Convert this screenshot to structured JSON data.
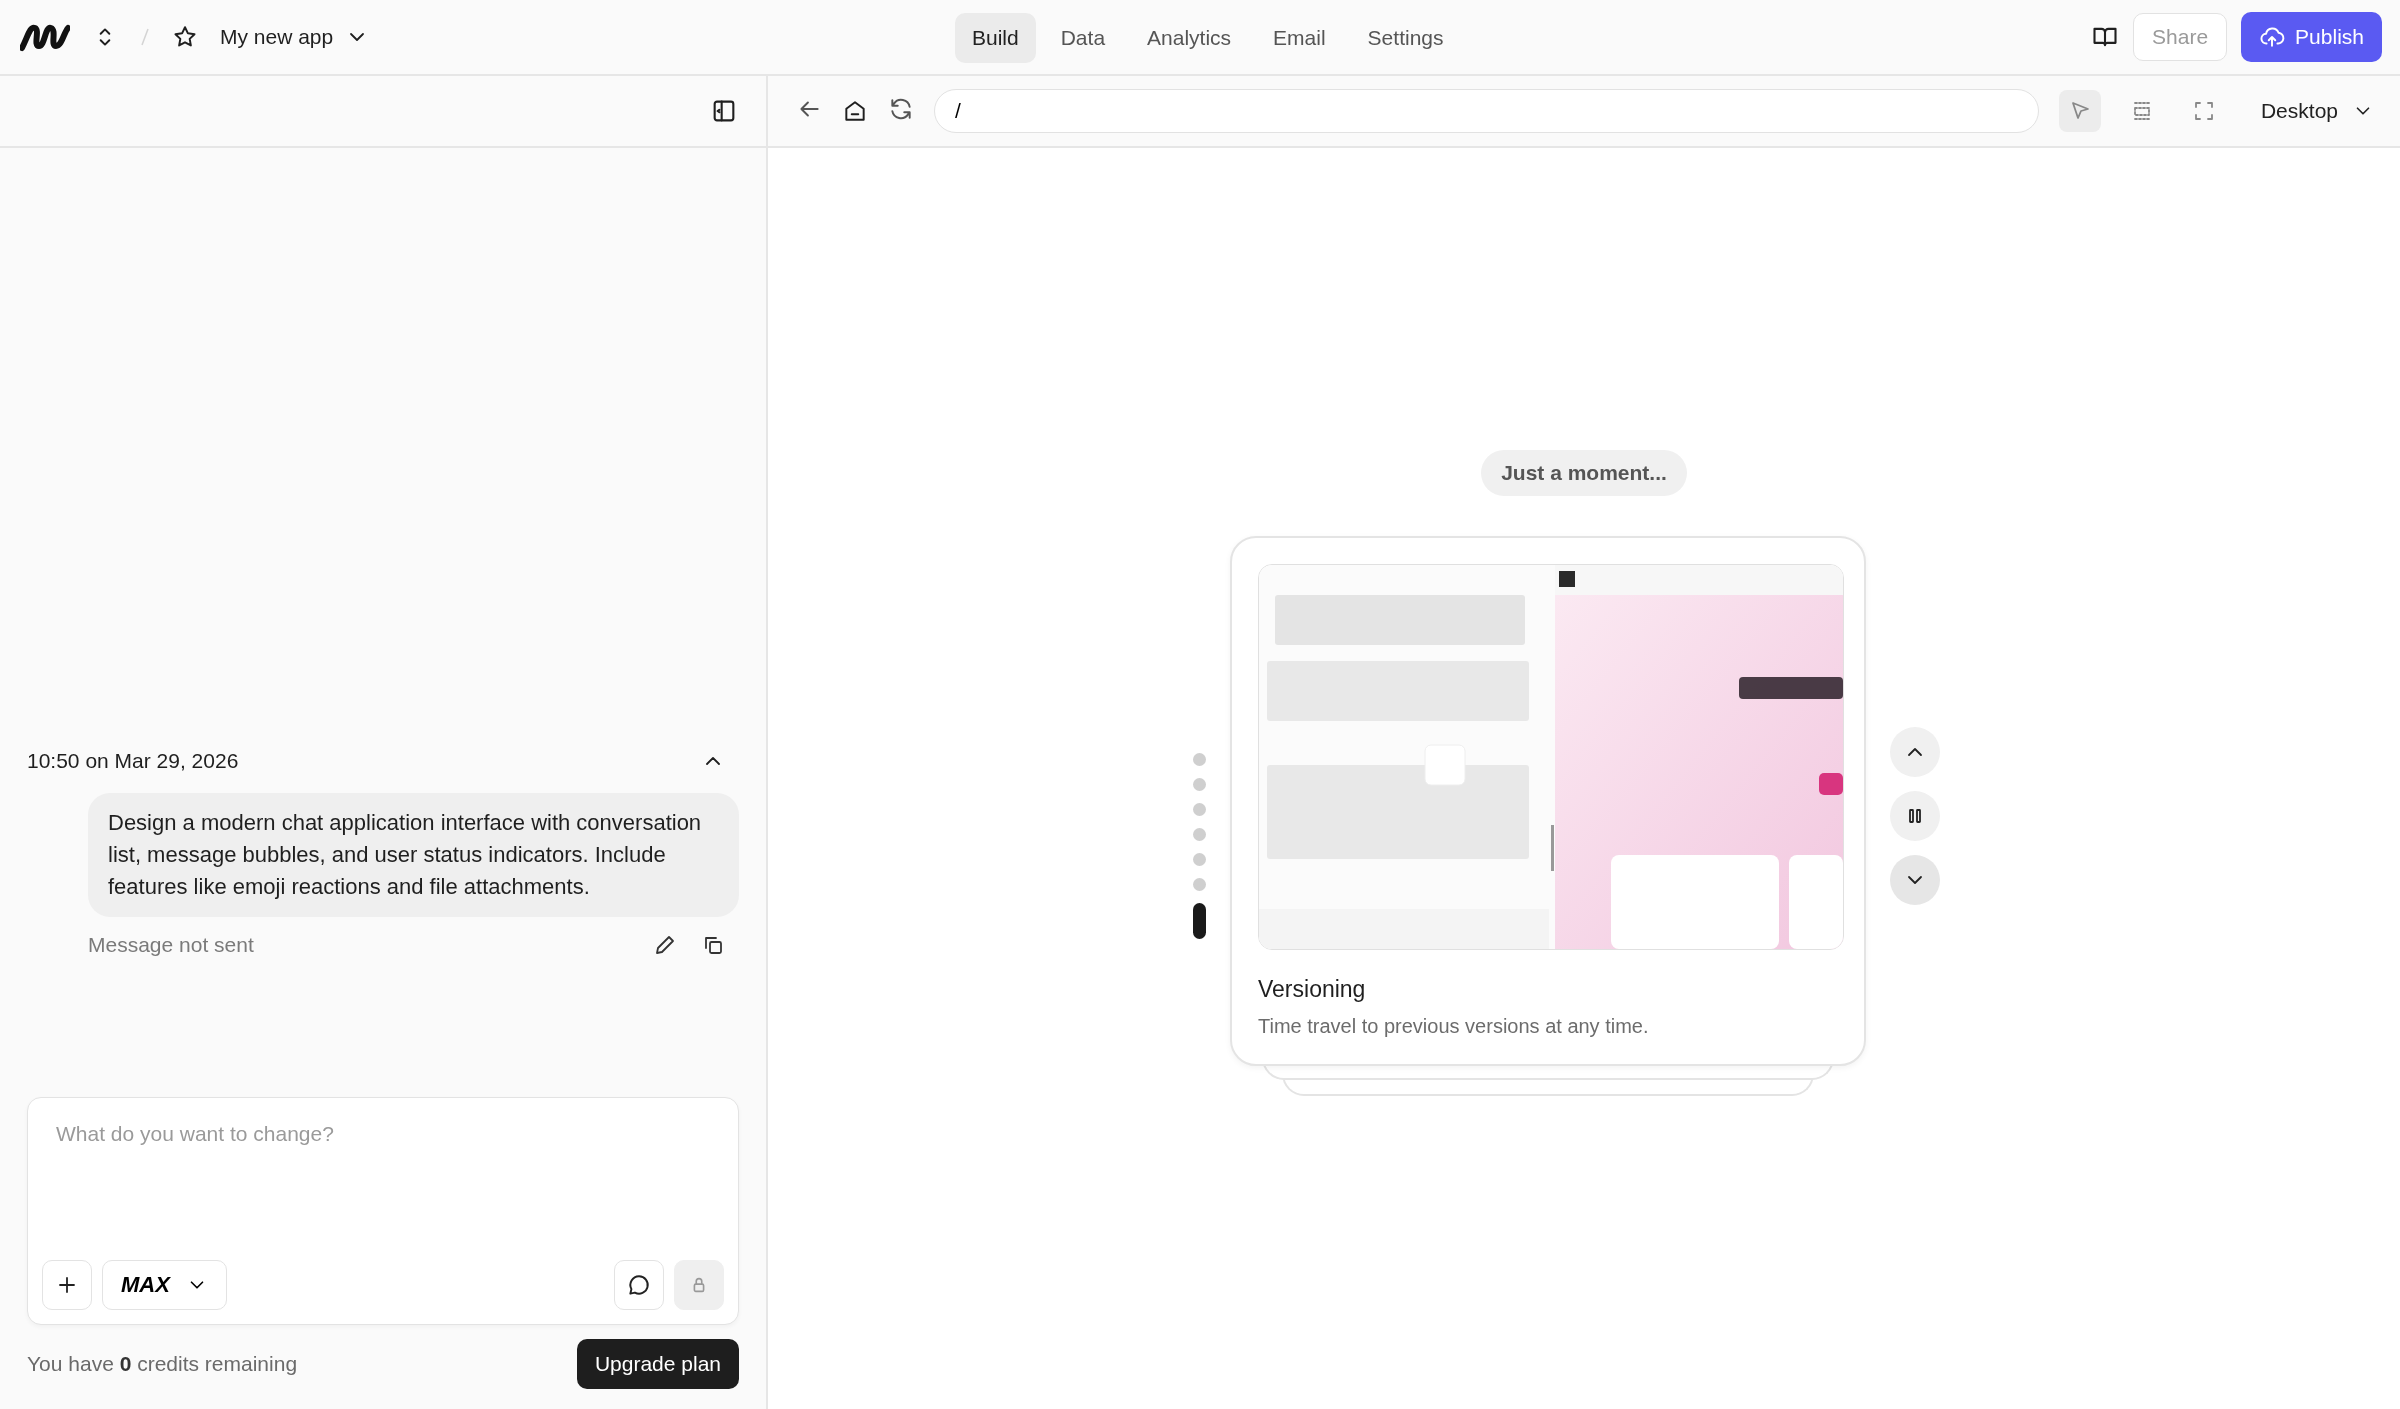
{
  "topbar": {
    "app_name": "My new app",
    "tabs": [
      {
        "label": "Build",
        "selected": true
      },
      {
        "label": "Data",
        "selected": false
      },
      {
        "label": "Analytics",
        "selected": false
      },
      {
        "label": "Email",
        "selected": false
      },
      {
        "label": "Settings",
        "selected": false
      }
    ],
    "share": "Share",
    "publish": "Publish"
  },
  "chat": {
    "timestamp": "10:50 on Mar 29, 2026",
    "message": "Design a modern chat application interface with conversation list, message bubbles, and user status indicators. Include features like emoji reactions and file attachments.",
    "status": "Message not sent",
    "composer": {
      "placeholder": "What do you want to change?",
      "model": "MAX"
    },
    "credits": "You have **0** credits remaining",
    "upgrade": "Upgrade plan"
  },
  "preview": {
    "url": "/",
    "device": "Desktop",
    "tools": [
      {
        "selected": true
      },
      {
        "selected": false
      },
      {
        "selected": false
      }
    ],
    "loading": "Just a moment...",
    "card": {
      "kind": "picture",
      "title": "Versioning",
      "description": "Time travel to previous versions at any time."
    },
    "pager": [
      {
        "selected": false
      },
      {
        "selected": false
      },
      {
        "selected": false
      },
      {
        "selected": false
      },
      {
        "selected": false
      },
      {
        "selected": false
      },
      {
        "selected": true
      }
    ]
  }
}
